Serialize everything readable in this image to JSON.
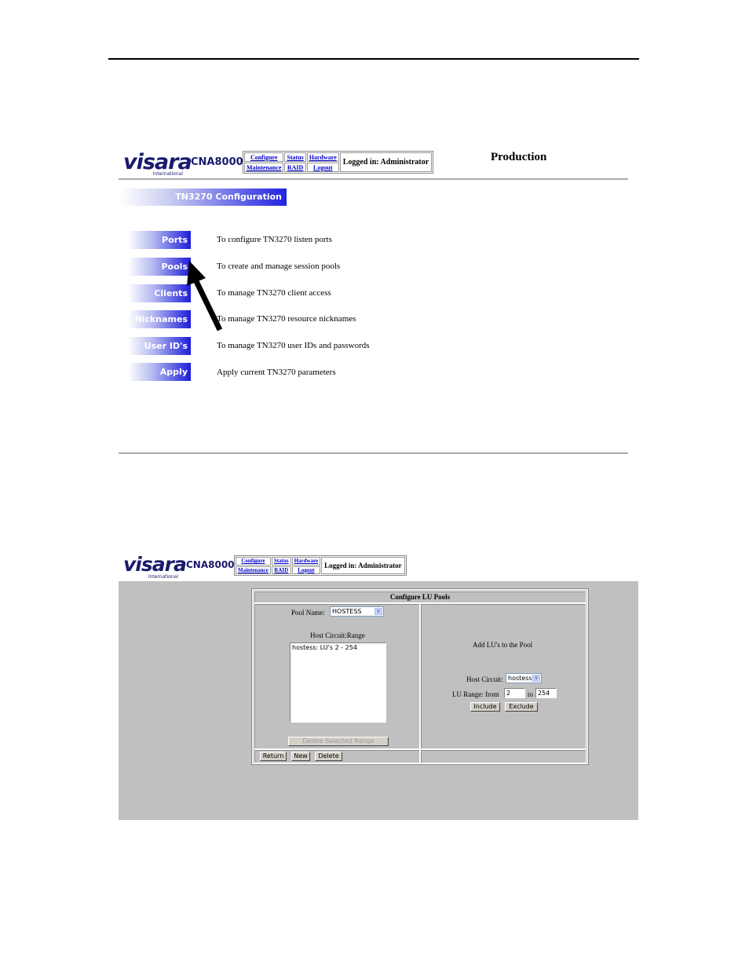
{
  "screen1": {
    "logo": {
      "word": "visara",
      "sub": "International"
    },
    "model": "CNA8000",
    "nav": {
      "configure": "Configure",
      "status": "Status",
      "hardware": "Hardware",
      "maintenance": "Maintenance",
      "raid": "RAID",
      "logout": "Logout",
      "logged_in": "Logged in: Administrator"
    },
    "environment": "Production",
    "section_title": "TN3270 Configuration",
    "menu": [
      {
        "label": "Ports",
        "desc": "To configure TN3270 listen ports"
      },
      {
        "label": "Pools",
        "desc": "To create and manage session pools"
      },
      {
        "label": "Clients",
        "desc": "To manage TN3270 client access"
      },
      {
        "label": "Nicknames",
        "desc": "To manage TN3270 resource nicknames"
      },
      {
        "label": "User ID's",
        "desc": "To manage TN3270 user IDs and passwords"
      },
      {
        "label": "Apply",
        "desc": "Apply current TN3270 parameters"
      }
    ]
  },
  "screen2": {
    "logo": {
      "word": "visara",
      "sub": "International"
    },
    "model": "CNA8000",
    "nav": {
      "configure": "Configure",
      "status": "Status",
      "hardware": "Hardware",
      "maintenance": "Maintenance",
      "raid": "RAID",
      "logout": "Logout",
      "logged_in": "Logged in: Administrator"
    },
    "form_title": "Configure LU Pools",
    "pool_name_label": "Pool Name:",
    "pool_name_value": "HOSTESS",
    "host_circuit_range_label": "Host Circuit:Range",
    "range_items": [
      "hostess: LU's 2 - 254"
    ],
    "delete_range_button": "Delete Selected Range",
    "add_title": "Add LU's to the Pool",
    "host_circuit_label": "Host Circuit:",
    "host_circuit_value": "hostess",
    "lu_range_label": "LU Range: from",
    "lu_from": "2",
    "to_label": "to",
    "lu_to": "254",
    "include_button": "Include",
    "exclude_button": "Exclude",
    "return_button": "Return",
    "new_button": "New",
    "delete_button": "Delete"
  },
  "colors": {
    "brand_blue": "#1a1a6e",
    "button_blue": "#1c1cd8",
    "panel_grey": "#c0c0c0"
  }
}
